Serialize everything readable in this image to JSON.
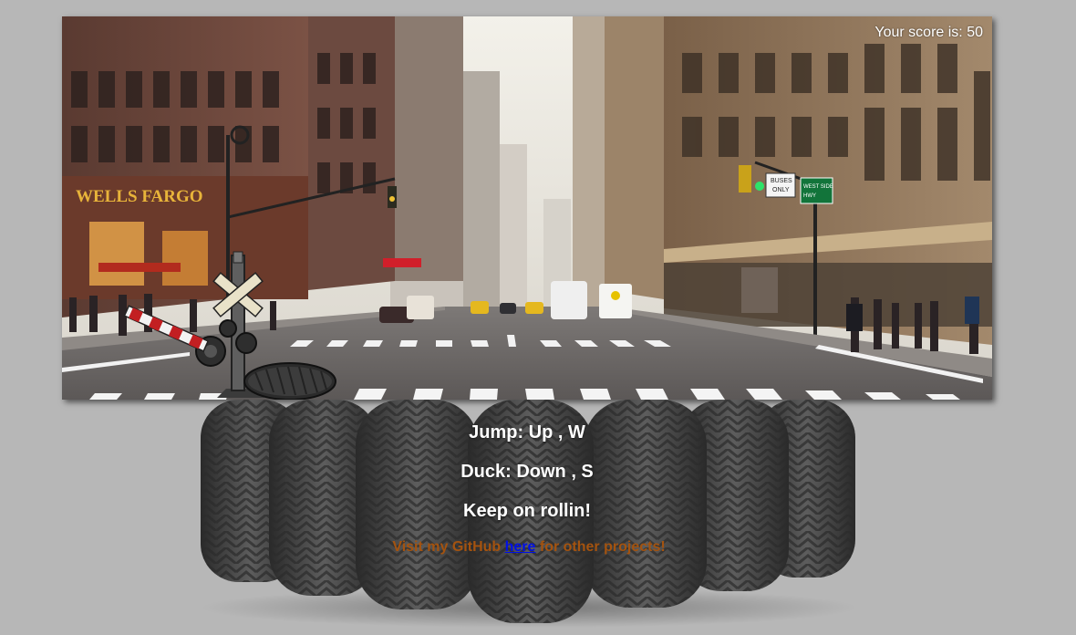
{
  "game": {
    "score_label": "Your score is:",
    "score_value": "50",
    "scene": {
      "bank_sign": "WELLS FARGO",
      "bus_sign_line1": "BUSES",
      "bus_sign_line2": "ONLY",
      "street_sign_line1": "WEST SIDE",
      "street_sign_line2": "HWY"
    }
  },
  "instructions": {
    "jump": "Jump: Up , W",
    "duck": "Duck: Down , S",
    "tagline": "Keep on rollin!"
  },
  "footer": {
    "prefix": "Visit my GitHub",
    "link_text": "here",
    "suffix": "for other projects!"
  },
  "colors": {
    "background": "#b7b7b7",
    "score_text": "#ffffff",
    "footer_text": "#a4530f",
    "link": "#0010e6"
  }
}
